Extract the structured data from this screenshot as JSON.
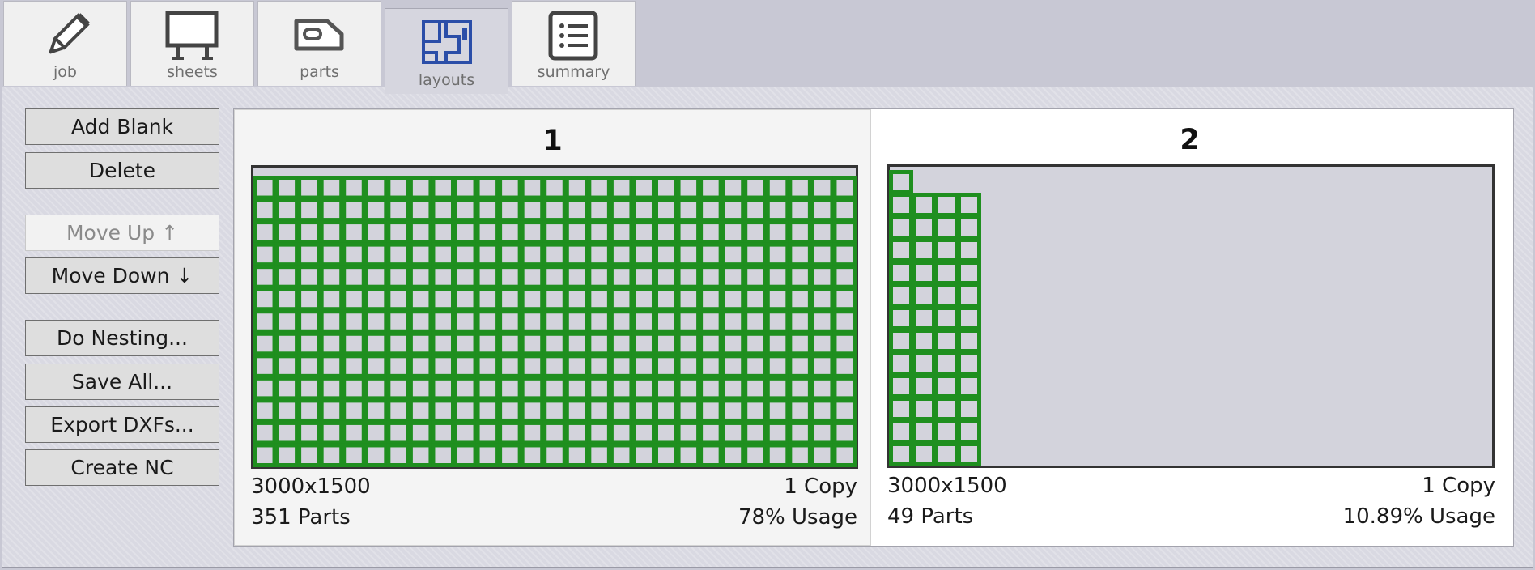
{
  "tabs": [
    {
      "label": "job",
      "icon": "pencil-icon",
      "active": false
    },
    {
      "label": "sheets",
      "icon": "sheet-table-icon",
      "active": false
    },
    {
      "label": "parts",
      "icon": "part-shape-icon",
      "active": false
    },
    {
      "label": "layouts",
      "icon": "layouts-icon",
      "active": true
    },
    {
      "label": "summary",
      "icon": "list-icon",
      "active": false
    }
  ],
  "sidebar": {
    "add_blank": "Add Blank",
    "delete": "Delete",
    "move_up": "Move Up ↑",
    "move_down": "Move Down ↓",
    "do_nesting": "Do Nesting...",
    "save_all": "Save All...",
    "export_dxfs": "Export DXFs...",
    "create_nc": "Create NC"
  },
  "colors": {
    "part_green": "#1f8f1f",
    "sheet_fill": "#d3d3dc",
    "accent_blue": "#2b4ea8"
  },
  "layouts": [
    {
      "number": "1",
      "sheet_size": "3000x1500",
      "copies": "1 Copy",
      "parts": "351 Parts",
      "usage": "78% Usage",
      "selected": true,
      "grid": {
        "columns": 27,
        "rows": 13
      }
    },
    {
      "number": "2",
      "sheet_size": "3000x1500",
      "copies": "1 Copy",
      "parts": "49 Parts",
      "usage": "10.89% Usage",
      "selected": false,
      "grid": {
        "columns": 4,
        "rows": 12,
        "extra_parts": 1
      }
    }
  ]
}
